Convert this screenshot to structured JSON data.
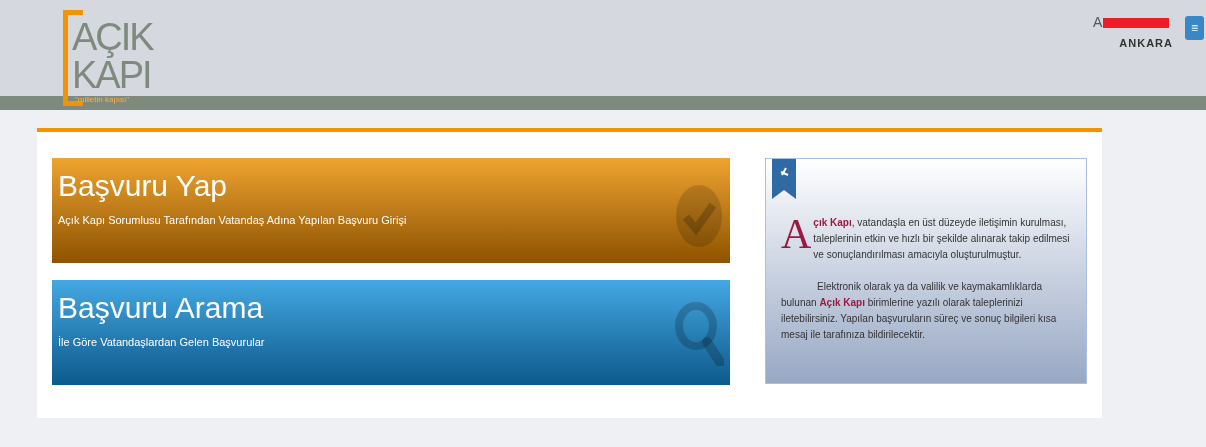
{
  "header": {
    "logo": {
      "line_1": "AÇIK",
      "line_2": "KAPI",
      "tagline": "\"milletin kapısı\""
    },
    "user": {
      "name": "A",
      "redacted": true,
      "city": "ANKARA"
    },
    "menu_button": "≡"
  },
  "tiles": [
    {
      "kind": "apply",
      "title": "Başvuru Yap",
      "subtitle": "Açık Kapı Sorumlusu Tarafından Vatandaş Adına Yapılan Başvuru Girişi"
    },
    {
      "kind": "search",
      "title": "Başvuru Arama",
      "subtitle": "İle Göre Vatandaşlardan Gelen Başvurular"
    }
  ],
  "info": {
    "drop_cap": "A",
    "paragraphs": [
      "**çık Kapı**, vatandaşla en üst düzeyde iletişimin kurulması, taleplerinin etkin ve hızlı bir şekilde alınarak takip edilmesi ve sonuçlandırılması amacıyla oluşturulmuştur.",
      "Elektronik olarak ya da valilik ve kaymakamlıklarda bulunan **Açık Kapı** birimlerine yazılı olarak taleplerinizi iletebilirsiniz. Yapılan başvuruların süreç ve sonuç bilgileri kısa mesaj ile tarafınıza bildirilecektir."
    ]
  }
}
